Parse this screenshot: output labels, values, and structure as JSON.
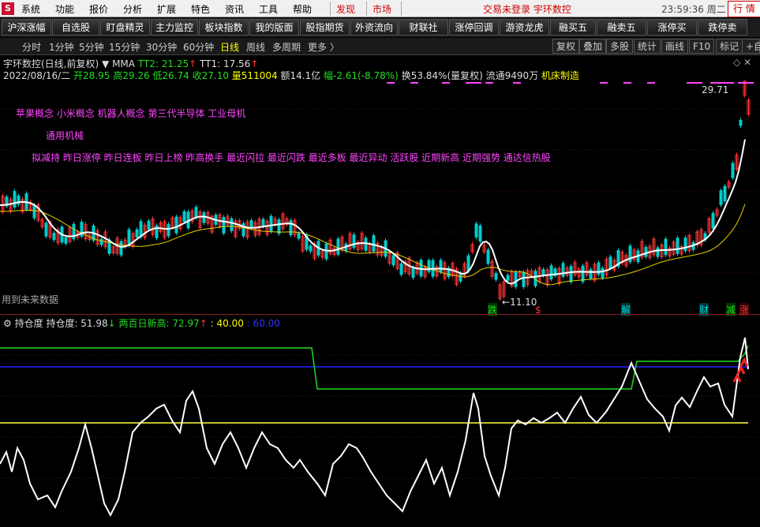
{
  "menubar": {
    "logo": "S",
    "items": [
      "系统",
      "功能",
      "报价",
      "分析",
      "扩展",
      "特色",
      "资讯",
      "工具",
      "帮助"
    ],
    "discover": "发现",
    "market": "市场",
    "status": "交易未登录  宇环数控",
    "clock": "23:59:36 周二",
    "quote": "行 情"
  },
  "toolbar": {
    "buttons": [
      "沪深涨幅",
      "自选股",
      "盯盘精灵",
      "主力监控",
      "板块指数",
      "我的版面",
      "股指期货",
      "外资流向",
      "财联社",
      "涨停回调",
      "游资龙虎",
      "融买五",
      "融卖五",
      "涨停买",
      "跌停卖"
    ]
  },
  "periods": {
    "items": [
      "分时",
      "1分钟",
      "5分钟",
      "15分钟",
      "30分钟",
      "60分钟",
      "日线",
      "周线",
      "多周期",
      "更多 〉"
    ],
    "active": "日线",
    "right": [
      "复权",
      "叠加",
      "多股",
      "统计",
      "画线",
      "F10",
      "标记",
      "+自"
    ]
  },
  "title": {
    "name": "宇环数控(日线,前复权)",
    "indicator": "MMA",
    "tt2": "TT2: 21.25",
    "tt1": "TT1: 17.56"
  },
  "quote": {
    "date": "2022/08/16/二",
    "open": "开28.95",
    "high": "高29.26",
    "low": "低26.74",
    "close": "收27.10",
    "volume": "量511004",
    "amount": "额14.1亿",
    "change": "幅-2.61(-8.78%)",
    "turnover": "换53.84%(量复权)",
    "float": "流通9490万",
    "industry": "机床制造"
  },
  "concepts": {
    "line1": "苹果概念 小米概念 机器人概念 第三代半导体 工业母机",
    "line2": "通用机械",
    "line3": "拟减持 昨日涨停 昨日连板 昨日上榜 昨高换手 最近闪拉 最近闪跌 最近多板 最近异动 活跃股 近期新高 近期强势 通达信热股"
  },
  "chart_labels": {
    "high_mark": "29.71",
    "low_mark": "11.10",
    "future_note": "用到未来数据"
  },
  "markers": [
    {
      "text": "跌",
      "color": "#22dd22"
    },
    {
      "text": "$",
      "color": "#ff3333"
    },
    {
      "text": "解",
      "color": "#00dddd"
    },
    {
      "text": "财",
      "color": "#00dddd"
    },
    {
      "text": "减",
      "color": "#22dd22"
    },
    {
      "text": "涨",
      "color": "#ff3333"
    }
  ],
  "sub": {
    "title": "持仓度",
    "hold": "持仓度: 51.98",
    "high200": "两百日新高: 72.97",
    "level40": ": 40.00",
    "level60": ": 60.00"
  },
  "colors": {
    "up": "#ff3333",
    "down": "#22dd22",
    "ma_white": "#ffffff",
    "ma_yellow": "#e6d200",
    "accent_blue": "#0000ff"
  }
}
